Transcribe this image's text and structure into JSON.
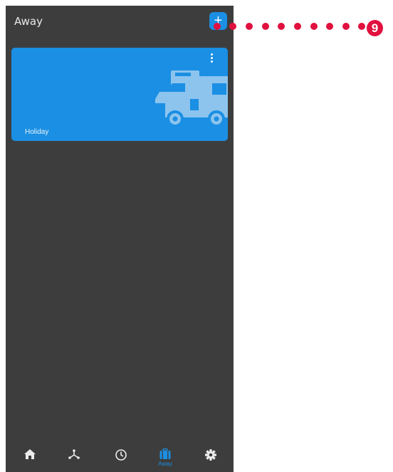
{
  "header": {
    "title": "Away",
    "add_label": "+"
  },
  "cards": [
    {
      "label": "Holiday",
      "icon": "campervan-icon"
    }
  ],
  "bottom_nav": {
    "items": [
      {
        "name": "home",
        "icon": "home-icon",
        "label": ""
      },
      {
        "name": "network",
        "icon": "network-icon",
        "label": ""
      },
      {
        "name": "schedule",
        "icon": "clock-icon",
        "label": ""
      },
      {
        "name": "away",
        "icon": "suitcase-icon",
        "label": "Away",
        "active": true
      },
      {
        "name": "settings",
        "icon": "gear-icon",
        "label": ""
      }
    ]
  },
  "callout": {
    "number": "9",
    "color": "#e0103f"
  },
  "colors": {
    "accent": "#1a8fe3",
    "background": "#3d3d3d",
    "callout": "#e0103f"
  }
}
